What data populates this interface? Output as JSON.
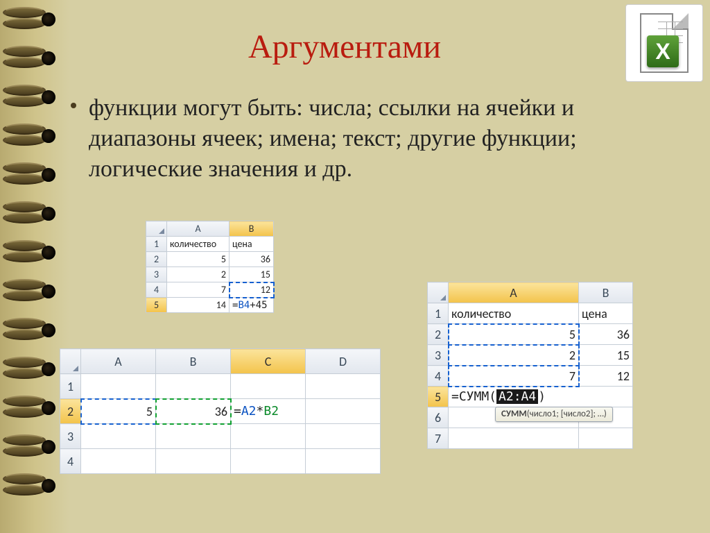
{
  "title": "Аргументами",
  "bullet": "функции могут быть: числа; ссылки на ячейки и диапазоны ячеек; имена; текст; другие функции; логические значения и др.",
  "logo": {
    "letter": "X"
  },
  "sheet1": {
    "columns": [
      "A",
      "B"
    ],
    "header_row": {
      "A": "количество",
      "B": "цена"
    },
    "rows": [
      {
        "r": "2",
        "A": "5",
        "B": "36"
      },
      {
        "r": "3",
        "A": "2",
        "B": "15"
      },
      {
        "r": "4",
        "A": "7",
        "B": "12"
      },
      {
        "r": "5",
        "A": "14",
        "B_prefix": "=",
        "B_ref": "B4",
        "B_suffix": "+45"
      }
    ]
  },
  "sheet2": {
    "columns": [
      "A",
      "B",
      "C",
      "D"
    ],
    "rows": [
      {
        "r": "1"
      },
      {
        "r": "2",
        "A": "5",
        "B": "36",
        "C_prefix": "=",
        "C_a": "A2",
        "C_op": "*",
        "C_b": "B2"
      },
      {
        "r": "3"
      },
      {
        "r": "4"
      }
    ]
  },
  "sheet3": {
    "columns": [
      "A",
      "B"
    ],
    "header_row": {
      "A": "количество",
      "B": "цена"
    },
    "rows": [
      {
        "r": "2",
        "A": "5",
        "B": "36"
      },
      {
        "r": "3",
        "A": "2",
        "B": "15"
      },
      {
        "r": "4",
        "A": "7",
        "B": "12"
      },
      {
        "r": "5",
        "A_prefix": "=СУММ(",
        "A_range": "A2:A4",
        "A_suffix": ")"
      },
      {
        "r": "6"
      },
      {
        "r": "7"
      }
    ],
    "tooltip": {
      "fn": "СУММ",
      "sig": "(число1; [число2]; …)"
    }
  }
}
